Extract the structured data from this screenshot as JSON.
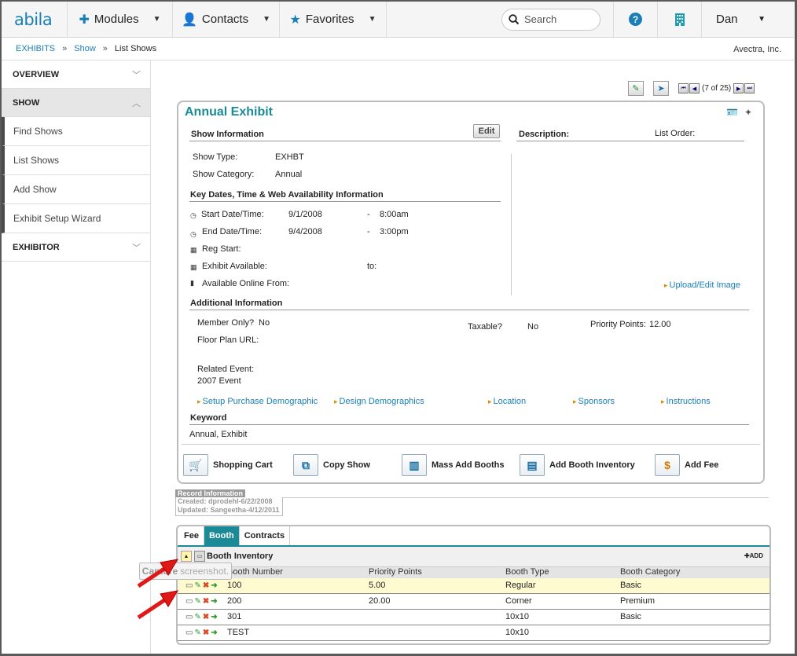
{
  "topnav": {
    "logo": "abila",
    "modules": "Modules",
    "contacts": "Contacts",
    "favorites": "Favorites",
    "search_placeholder": "Search",
    "help": "?",
    "user": "Dan"
  },
  "breadcrumb": {
    "items": [
      "EXHIBITS",
      "Show",
      "List Shows"
    ],
    "org": "Avectra, Inc."
  },
  "sidebar": {
    "sections": [
      "OVERVIEW",
      "SHOW",
      "EXHIBITOR"
    ],
    "items": [
      "Find Shows",
      "List Shows",
      "Add Show",
      "Exhibit Setup Wizard"
    ]
  },
  "pager": {
    "text": "(7 of 25)"
  },
  "show": {
    "title": "Annual Exhibit",
    "show_info_heading": "Show Information",
    "edit_label": "Edit",
    "description_label": "Description:",
    "list_order_label": "List Order:",
    "show_type_label": "Show Type:",
    "show_type": "EXHBT",
    "show_category_label": "Show Category:",
    "show_category": "Annual",
    "key_dates_heading": "Key Dates, Time & Web Availability Information",
    "start_label": "Start Date/Time:",
    "start_date": "9/1/2008",
    "start_time": "8:00am",
    "end_label": "End Date/Time:",
    "end_date": "9/4/2008",
    "end_time": "3:00pm",
    "dash": "-",
    "reg_start_label": "Reg Start:",
    "exhibit_available_label": "Exhibit Available:",
    "to_label": "to:",
    "available_online_label": "Available Online From:",
    "upload_link": "Upload/Edit Image",
    "additional_heading": "Additional Information",
    "member_only_label": "Member Only?",
    "member_only": "No",
    "taxable_label": "Taxable?",
    "taxable": "No",
    "priority_label": "Priority Points:",
    "priority": "12.00",
    "floor_plan_label": "Floor Plan URL:",
    "related_event_label": "Related Event:",
    "related_event": "2007 Event",
    "links": [
      "Setup Purchase Demographic",
      "Design Demographics",
      "Location",
      "Sponsors",
      "Instructions"
    ],
    "keyword_heading": "Keyword",
    "keywords": "Annual, Exhibit",
    "actions": [
      "Shopping Cart",
      "Copy Show",
      "Mass Add Booths",
      "Add Booth Inventory",
      "Add Fee"
    ]
  },
  "record": {
    "heading": "Record Information",
    "created": "Created: dprodehl-6/22/2008",
    "updated": "Updated: Sangeetha-4/12/2011"
  },
  "tabs": [
    "Fee",
    "Booth",
    "Contracts"
  ],
  "booth_inventory": {
    "title": "Booth Inventory",
    "add_label": "ADD",
    "columns": [
      "Booth Number",
      "Priority Points",
      "Booth Type",
      "Booth Category"
    ],
    "rows": [
      [
        "100",
        "5.00",
        "Regular",
        "Basic"
      ],
      [
        "200",
        "20.00",
        "Corner",
        "Premium"
      ],
      [
        "301",
        "",
        "10x10",
        "Basic"
      ],
      [
        "TEST",
        "",
        "10x10",
        ""
      ]
    ]
  },
  "tooltip": {
    "bold": "Capture",
    "rest": "screenshot."
  },
  "colors": {
    "accent": "#1a8a96",
    "link": "#1a7fb5",
    "arrow": "#e01818"
  }
}
